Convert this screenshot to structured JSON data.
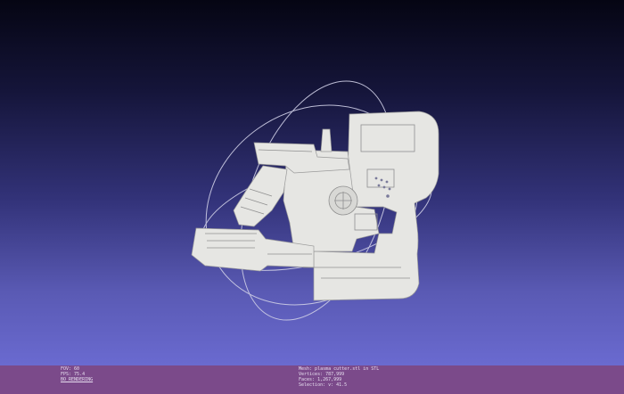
{
  "window": {
    "title": ""
  },
  "scene": {
    "model_name": "ray gun shaped 3D mesh",
    "trackball": true,
    "background_gradient": [
      "#050513",
      "#6a6ad0"
    ],
    "mesh_color": "#e6e6e3"
  },
  "status": {
    "left": {
      "fov": "FOV: 60",
      "fps": "FPS:   75.4",
      "renderer": "BO_RENDERING"
    },
    "right": {
      "mesh": "Mesh: plasma cutter.stl in STL",
      "vertices": "Vertices: 787,999",
      "faces": "Faces: 1,267,999",
      "selection": "Selection: v: 41.5"
    }
  }
}
